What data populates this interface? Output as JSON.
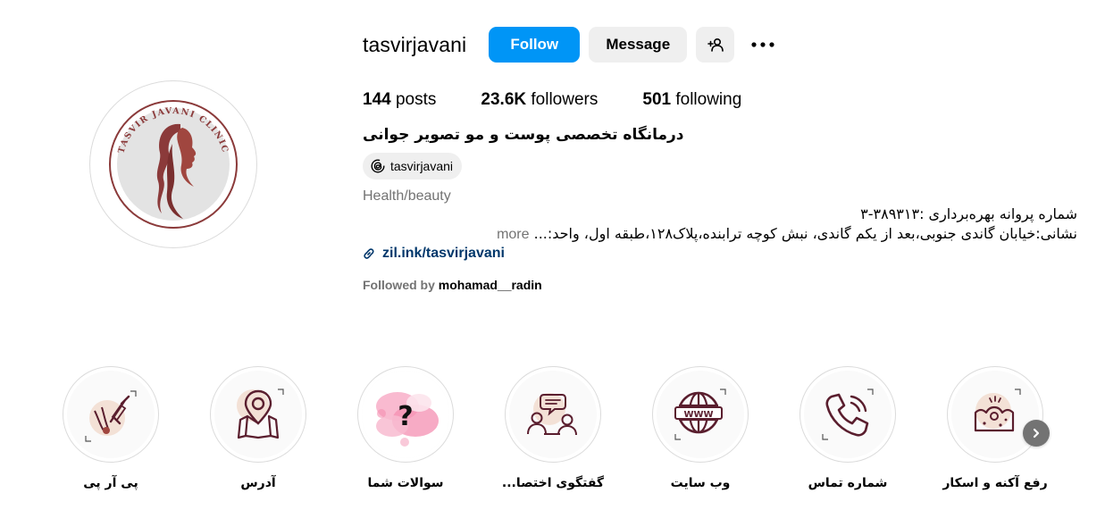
{
  "profile": {
    "username": "tasvirjavani",
    "follow_label": "Follow",
    "message_label": "Message",
    "avatar_text": "TASVIR JAVANI CLINIC"
  },
  "stats": {
    "posts_count": "144",
    "posts_label": "posts",
    "followers_count": "23.6K",
    "followers_label": "followers",
    "following_count": "501",
    "following_label": "following"
  },
  "bio": {
    "name": "درمانگاه تخصصی پوست و مو تصویر جوانی",
    "threads_handle": "tasvirjavani",
    "category": "Health/beauty",
    "line1": "شماره پروانه بهره‌برداری :۳۸۹۳۱۳-۳",
    "line2": "نشانی:خیابان گاندی جنوبی،بعد از یکم گاندی، نبش کوچه ترابنده،پلاک۱۲۸،طبقه اول، واحد:...",
    "more_label": "more",
    "link": "zil.ink/tasvirjavani",
    "followed_by_prefix": "Followed by",
    "followed_by_user": "mohamad__radin"
  },
  "highlights": [
    {
      "label": "پی آر پی",
      "icon": "prp-syringe-icon"
    },
    {
      "label": "آدرس",
      "icon": "map-pin-icon"
    },
    {
      "label": "سوالات شما",
      "icon": "question-icon"
    },
    {
      "label": "گفتگوی اختصا...",
      "icon": "consultation-icon"
    },
    {
      "label": "وب سایت",
      "icon": "globe-www-icon"
    },
    {
      "label": "شماره تماس",
      "icon": "phone-icon"
    },
    {
      "label": "رفع آکنه و اسکار",
      "icon": "skin-acne-icon"
    }
  ],
  "colors": {
    "follow_blue": "#0095f6",
    "button_gray": "#efefef",
    "secondary_text": "#737373",
    "link_color": "#00376b",
    "brand_maroon": "#8b3a3a",
    "icon_dark": "#5a1e2e"
  }
}
